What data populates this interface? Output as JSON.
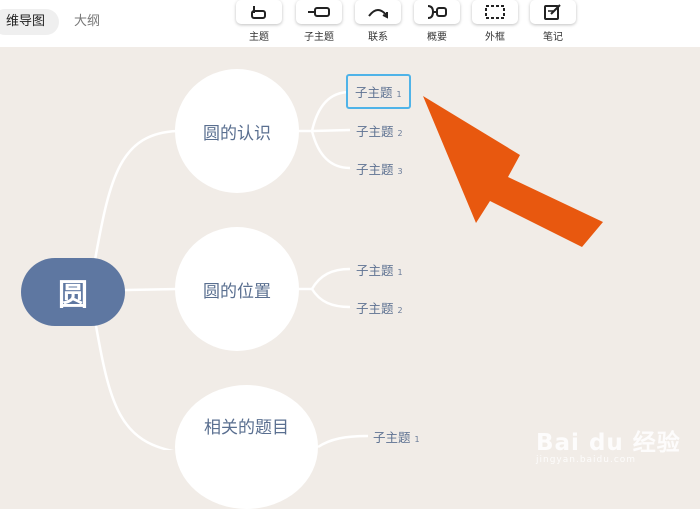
{
  "view_tabs": [
    {
      "label": "维导图",
      "active": true
    },
    {
      "label": "大纲",
      "active": false
    }
  ],
  "toolbar": [
    {
      "label": "主题",
      "icon": "topic-icon"
    },
    {
      "label": "子主题",
      "icon": "subtopic-icon"
    },
    {
      "label": "联系",
      "icon": "relationship-icon"
    },
    {
      "label": "概要",
      "icon": "summary-icon"
    },
    {
      "label": "外框",
      "icon": "boundary-icon"
    },
    {
      "label": "笔记",
      "icon": "note-icon"
    }
  ],
  "mindmap": {
    "root": "圆",
    "branches": [
      {
        "label": "圆的认识",
        "subtopics": [
          {
            "label": "子主题",
            "num": "1",
            "selected": true
          },
          {
            "label": "子主题",
            "num": "2"
          },
          {
            "label": "子主题",
            "num": "3"
          }
        ]
      },
      {
        "label": "圆的位置",
        "subtopics": [
          {
            "label": "子主题",
            "num": "1"
          },
          {
            "label": "子主题",
            "num": "2"
          }
        ]
      },
      {
        "label": "相关的题目",
        "subtopics": [
          {
            "label": "子主题",
            "num": "1"
          }
        ]
      }
    ]
  },
  "colors": {
    "accent_arrow": "#e8580f",
    "root_fill": "#5e77a1",
    "selection": "#4fb3e8",
    "canvas": "#f1ece7"
  },
  "watermark": {
    "brand": "Bai du 经验",
    "url": "jingyan.baidu.com"
  }
}
